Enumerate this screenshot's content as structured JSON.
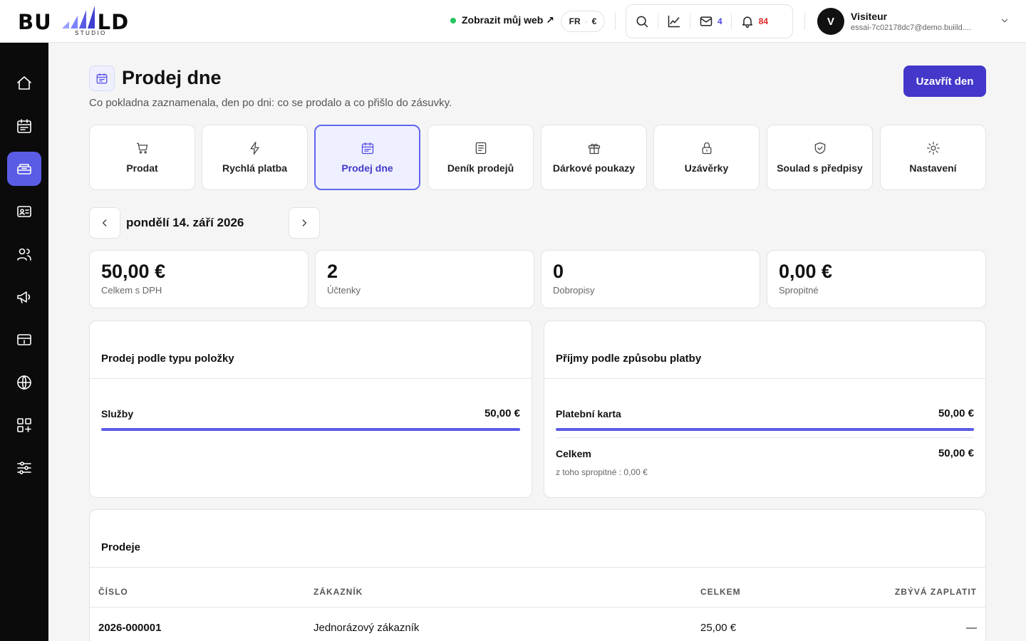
{
  "logo": {
    "word_left": "BU",
    "word_right": "LD",
    "sub": "STUDIO"
  },
  "header": {
    "web_link": "Zobrazit můj web ↗",
    "lang": "FR",
    "currency": "€",
    "mail_count": "4",
    "notif_count": "84",
    "user_initial": "V",
    "user_name": "Visiteur",
    "user_email": "essai-7c02178dc7@demo.buiild...."
  },
  "sidebar": {
    "items": [
      {
        "icon": "home-icon"
      },
      {
        "icon": "calendar-icon"
      },
      {
        "icon": "register-icon",
        "active": true
      },
      {
        "icon": "contact-card-icon"
      },
      {
        "icon": "users-icon"
      },
      {
        "icon": "megaphone-icon"
      },
      {
        "icon": "payment-card-icon"
      },
      {
        "icon": "globe-icon"
      },
      {
        "icon": "apps-icon"
      },
      {
        "icon": "sliders-icon"
      }
    ]
  },
  "page": {
    "title": "Prodej dne",
    "subtitle": "Co pokladna zaznamenala, den po dni: co se prodalo a co přišlo do zásuvky.",
    "close_day_button": "Uzavřít den"
  },
  "tabs": [
    {
      "label": "Prodat",
      "icon": "cart-icon"
    },
    {
      "label": "Rychlá platba",
      "icon": "lightning-icon"
    },
    {
      "label": "Prodej dne",
      "icon": "calendar-icon",
      "active": true
    },
    {
      "label": "Deník prodejů",
      "icon": "journal-icon"
    },
    {
      "label": "Dárkové poukazy",
      "icon": "gift-icon"
    },
    {
      "label": "Uzávěrky",
      "icon": "lock-icon"
    },
    {
      "label": "Soulad s předpisy",
      "icon": "shield-icon"
    },
    {
      "label": "Nastavení",
      "icon": "sun-icon"
    }
  ],
  "date_nav": {
    "date": "pondělí 14. září 2026"
  },
  "stats": [
    {
      "value": "50,00 €",
      "label": "Celkem s DPH"
    },
    {
      "value": "2",
      "label": "Účtenky"
    },
    {
      "value": "0",
      "label": "Dobropisy"
    },
    {
      "value": "0,00 €",
      "label": "Spropitné"
    }
  ],
  "by_type": {
    "title": "Prodej podle typu položky",
    "rows": [
      {
        "label": "Služby",
        "value": "50,00 €",
        "share": 1.0
      }
    ]
  },
  "by_payment": {
    "title": "Příjmy podle způsobu platby",
    "rows": [
      {
        "label": "Platební karta",
        "value": "50,00 €",
        "share": 1.0
      }
    ],
    "total_label": "Celkem",
    "total_value": "50,00 €",
    "tip_note": "z toho spropitné : 0,00 €"
  },
  "sales": {
    "title": "Prodeje",
    "columns": [
      "ČÍSLO",
      "ZÁKAZNÍK",
      "CELKEM",
      "ZBÝVÁ ZAPLATIT"
    ],
    "rows": [
      {
        "number": "2026-000001",
        "customer": "Jednorázový zákazník",
        "total": "25,00 €",
        "remaining": "—"
      }
    ]
  },
  "colors": {
    "accent": "#5b5ce6",
    "primary_button": "#4338ca",
    "sidebar_bg": "#0b0b0b",
    "online": "#22c55e",
    "notif": "#dc2626"
  }
}
